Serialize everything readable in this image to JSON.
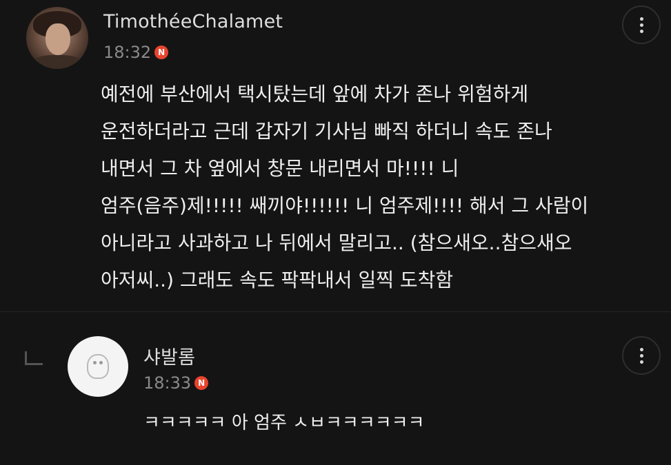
{
  "main_comment": {
    "username": "TimothéeChalamet",
    "time": "18:32",
    "badge": "N",
    "text": "예전에 부산에서 택시탔는데 앞에 차가 존나 위험하게\n운전하더라고 근데 갑자기 기사님 빠직 하더니 속도 존나\n내면서 그 차 옆에서 창문 내리면서 마!!!! 니\n엄주(음주)제!!!!! 쌔끼야!!!!!! 니 엄주제!!!! 해서 그 사람이\n아니라고 사과하고 나 뒤에서 말리고.. (참으새오..참으새오\n아저씨..) 그래도 속도 팍팍내서 일찍 도착함"
  },
  "reply_comment": {
    "username": "샤발롬",
    "time": "18:33",
    "badge": "N",
    "text": "ㅋㅋㅋㅋㅋ 아 엄주 ㅅㅂㅋㅋㅋㅋㅋㅋ"
  },
  "colors": {
    "background": "#141414",
    "badge": "#e8442e",
    "timestamp": "#8a8a8a"
  },
  "icons": {
    "more": "vertical-ellipsis-icon",
    "reply": "reply-arrow-icon"
  }
}
